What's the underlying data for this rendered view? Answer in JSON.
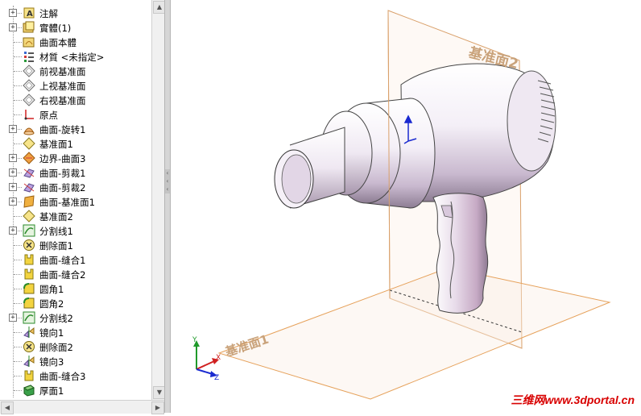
{
  "feature_tree": {
    "items": [
      {
        "label": "注解",
        "icon": "annotation-icon",
        "expandable": true
      },
      {
        "label": "實體(1)",
        "icon": "solid-bodies-icon",
        "expandable": true
      },
      {
        "label": "曲面本體",
        "icon": "surface-bodies-icon",
        "expandable": false
      },
      {
        "label": "材質 <未指定>",
        "icon": "material-icon",
        "expandable": false
      },
      {
        "label": "前视基准面",
        "icon": "plane-icon",
        "expandable": false
      },
      {
        "label": "上视基准面",
        "icon": "plane-icon",
        "expandable": false
      },
      {
        "label": "右视基准面",
        "icon": "plane-icon",
        "expandable": false
      },
      {
        "label": "原点",
        "icon": "origin-icon",
        "expandable": false
      },
      {
        "label": "曲面-旋转1",
        "icon": "revolve-surface-icon",
        "expandable": true
      },
      {
        "label": "基准面1",
        "icon": "ref-plane-icon",
        "expandable": false
      },
      {
        "label": "边界-曲面3",
        "icon": "boundary-surface-icon",
        "expandable": true
      },
      {
        "label": "曲面-剪裁1",
        "icon": "trim-surface-icon",
        "expandable": true
      },
      {
        "label": "曲面-剪裁2",
        "icon": "trim-surface-icon",
        "expandable": true
      },
      {
        "label": "曲面-基准面1",
        "icon": "planar-surface-icon",
        "expandable": true
      },
      {
        "label": "基准面2",
        "icon": "ref-plane-icon",
        "expandable": false
      },
      {
        "label": "分割线1",
        "icon": "split-line-icon",
        "expandable": true
      },
      {
        "label": "删除面1",
        "icon": "delete-face-icon",
        "expandable": false
      },
      {
        "label": "曲面-缝合1",
        "icon": "knit-surface-icon",
        "expandable": false
      },
      {
        "label": "曲面-缝合2",
        "icon": "knit-surface-icon",
        "expandable": false
      },
      {
        "label": "圆角1",
        "icon": "fillet-icon",
        "expandable": false
      },
      {
        "label": "圆角2",
        "icon": "fillet-icon",
        "expandable": false
      },
      {
        "label": "分割线2",
        "icon": "split-line-icon",
        "expandable": true
      },
      {
        "label": "镜向1",
        "icon": "mirror-icon",
        "expandable": false
      },
      {
        "label": "删除面2",
        "icon": "delete-face-icon",
        "expandable": false
      },
      {
        "label": "镜向3",
        "icon": "mirror-icon",
        "expandable": false
      },
      {
        "label": "曲面-缝合3",
        "icon": "knit-surface-icon",
        "expandable": false
      },
      {
        "label": "厚面1",
        "icon": "thicken-icon",
        "expandable": false
      }
    ]
  },
  "viewport": {
    "plane_label_right": "基准面2",
    "plane_label_bottom": "基准面1",
    "triad": {
      "x": "X",
      "y": "Y",
      "z": "Z"
    },
    "plane_color": "#e6a15a",
    "model_color": "#f3eef6"
  },
  "watermark": "三维网www.3dportal.cn"
}
